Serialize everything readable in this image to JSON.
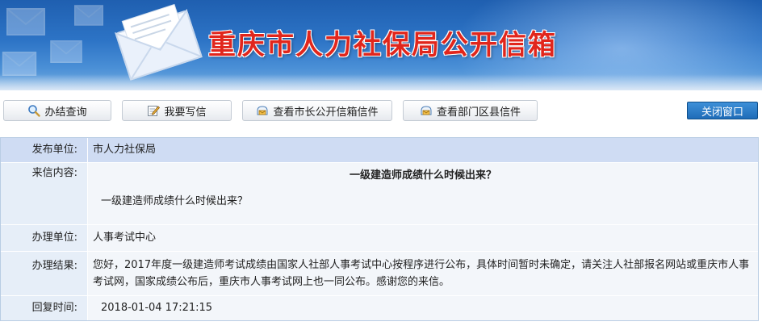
{
  "banner": {
    "title": "重庆市人力社保局公开信箱"
  },
  "toolbar": {
    "query_label": "办结查询",
    "write_label": "我要写信",
    "mayor_label": "查看市长公开信箱信件",
    "dept_label": "查看部门区县信件",
    "close_label": "关闭窗口"
  },
  "detail": {
    "publisher_label": "发布单位:",
    "publisher": "市人力社保局",
    "content_label": "来信内容:",
    "letter_title": "一级建造师成绩什么时候出来？",
    "letter_body": "一级建造师成绩什么时候出来？",
    "handler_label": "办理单位:",
    "handler": "人事考试中心",
    "result_label": "办理结果:",
    "result": "您好，2017年度一级建造师考试成绩由国家人社部人事考试中心按程序进行公布，具体时间暂时未确定，请关注人社部报名网站或重庆市人事考试网，国家成绩公布后，重庆市人事考试网上也一同公布。感谢您的来信。",
    "reply_time_label": "回复时间:",
    "reply_time": "2018-01-04 17:21:15"
  },
  "colors": {
    "banner_blue": "#2d74c6",
    "title_red": "#e1261c",
    "header_row": "#cfdcf3",
    "label_cell": "#e6eef8",
    "close_button": "#1f6cb8"
  },
  "icons": {
    "query": "magnifier-icon",
    "write": "pencil-note-icon",
    "mayor": "mailbox-icon",
    "dept": "mailbox-icon",
    "banner": "envelope-icon"
  }
}
